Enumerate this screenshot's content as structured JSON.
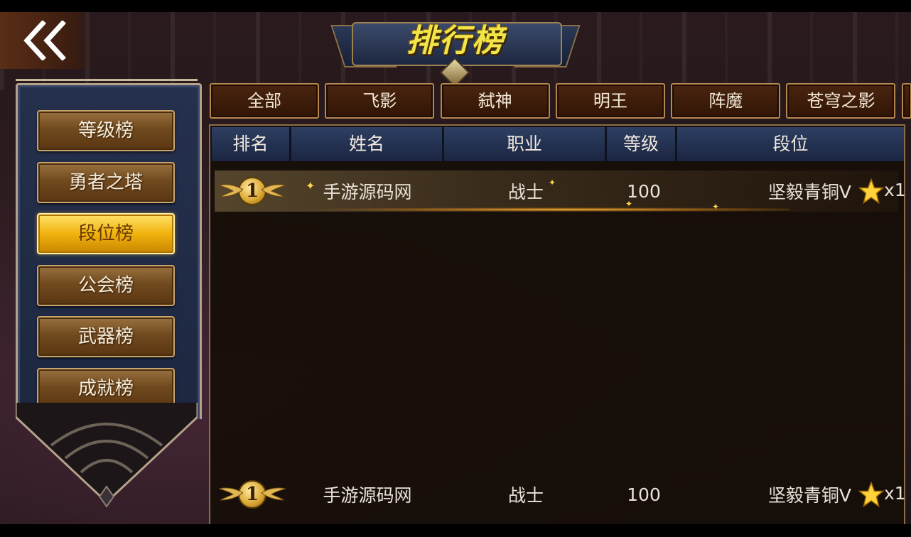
{
  "title": "排行榜",
  "nav": {
    "back_icon": "double-chevron-left-icon"
  },
  "sidebar": {
    "items": [
      {
        "label": "等级榜",
        "active": false
      },
      {
        "label": "勇者之塔",
        "active": false
      },
      {
        "label": "段位榜",
        "active": true
      },
      {
        "label": "公会榜",
        "active": false
      },
      {
        "label": "武器榜",
        "active": false
      },
      {
        "label": "成就榜",
        "active": false
      }
    ]
  },
  "tabs": [
    "全部",
    "飞影",
    "弑神",
    "明王",
    "阵魔",
    "苍穹之影"
  ],
  "table": {
    "headers": [
      "排名",
      "姓名",
      "职业",
      "等级",
      "段位"
    ],
    "rows": [
      {
        "rank": "1",
        "name": "手游源码网",
        "class": "战士",
        "level": "100",
        "tier": "坚毅青铜V",
        "stars": "x1"
      }
    ],
    "self_row": {
      "rank": "1",
      "name": "手游源码网",
      "class": "战士",
      "level": "100",
      "tier": "坚毅青铜V",
      "stars": "x1"
    }
  },
  "colors": {
    "accent_gold": "#f0b30e",
    "title_yellow": "#f2e54a",
    "header_blue": "#2e3f63"
  }
}
